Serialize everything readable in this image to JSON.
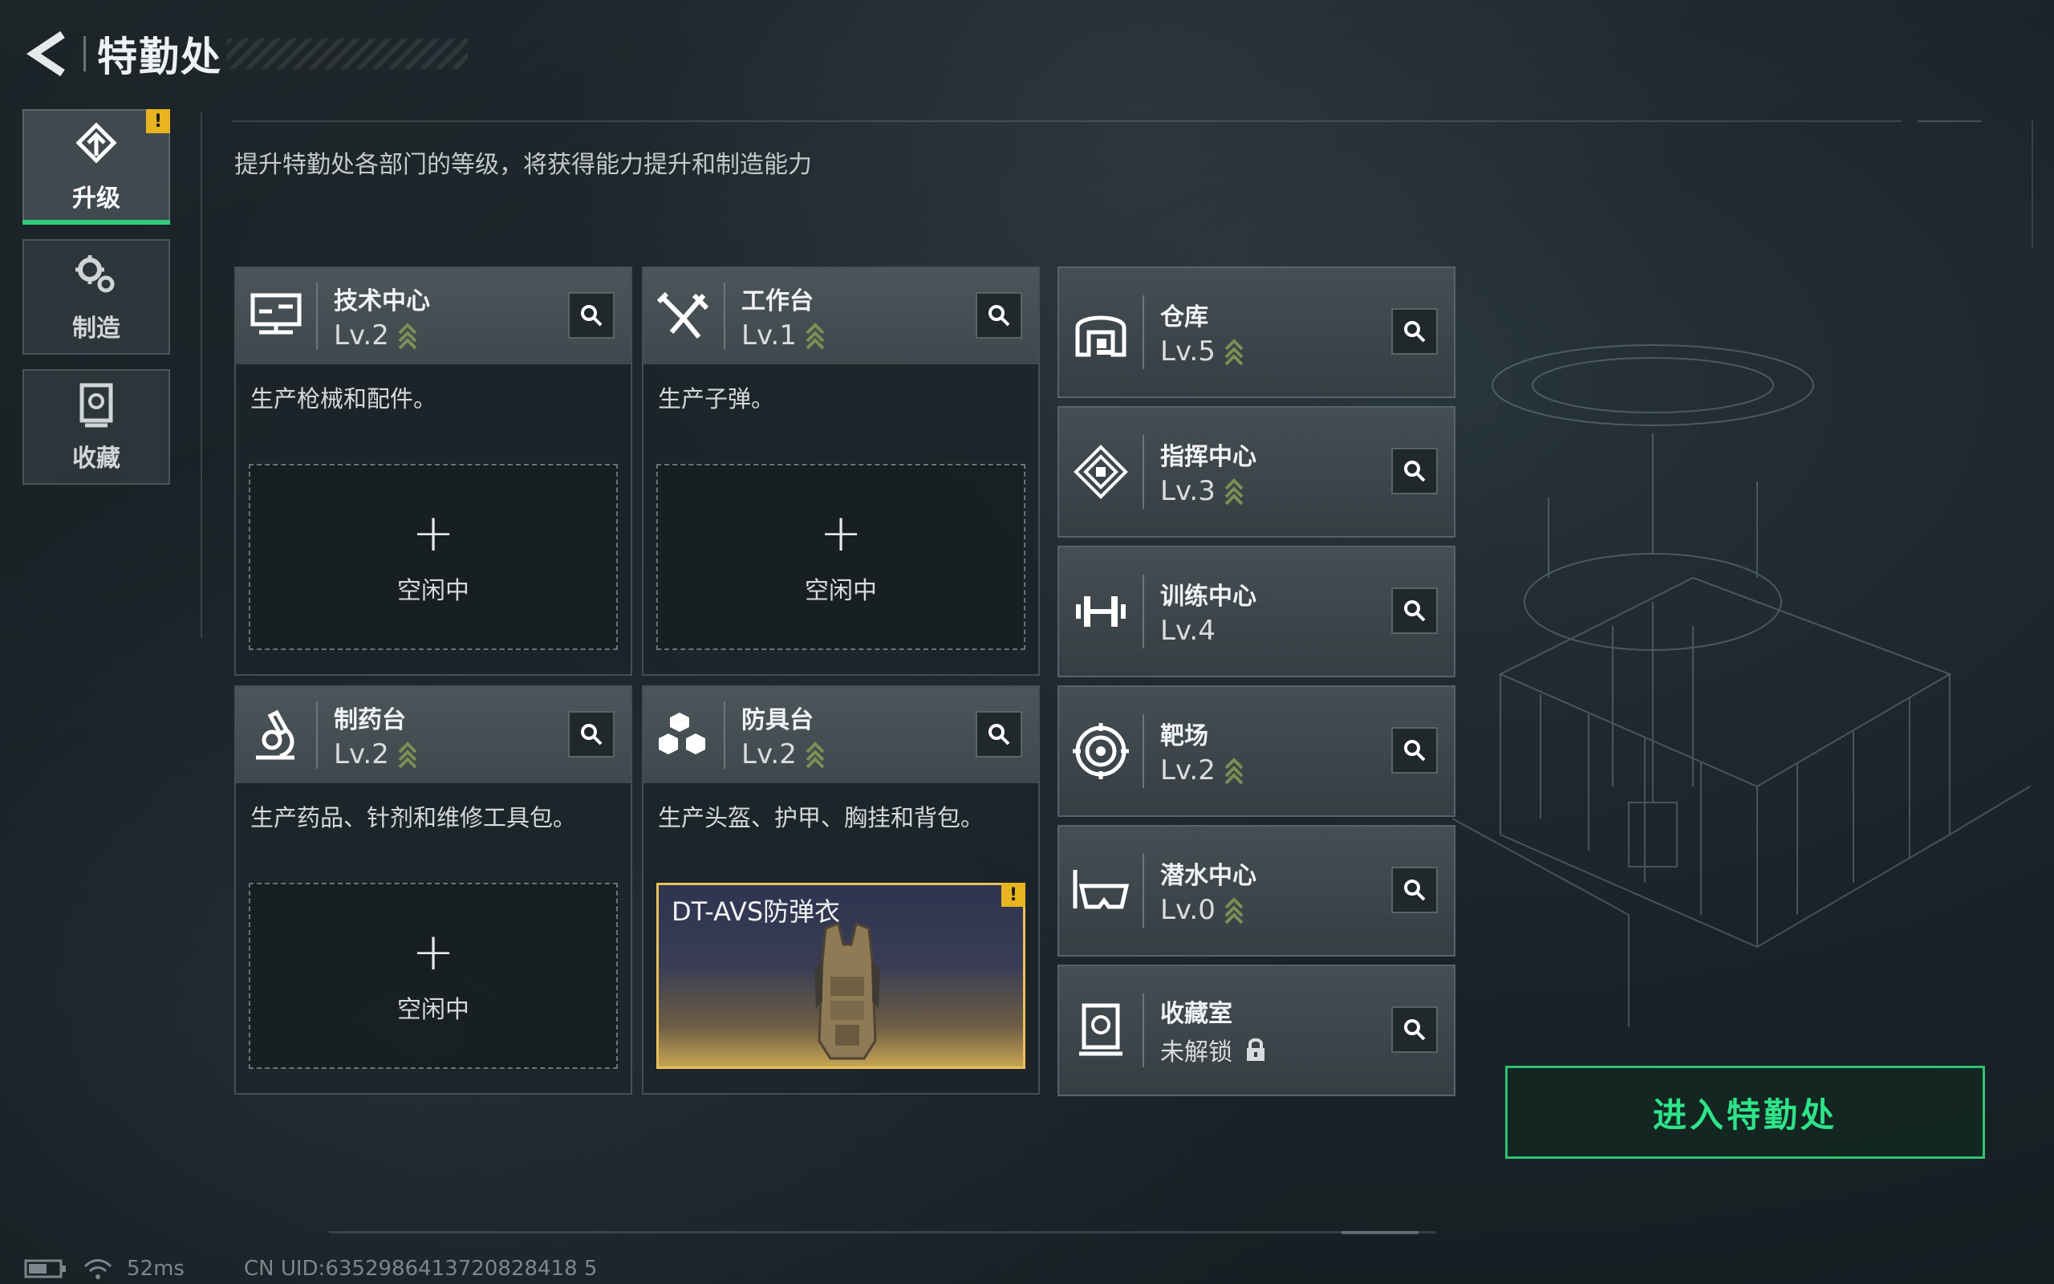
{
  "header": {
    "title": "特勤处"
  },
  "nav": [
    {
      "label": "升级",
      "icon": "upgrade-icon",
      "active": true,
      "alert": "!"
    },
    {
      "label": "制造",
      "icon": "gears-icon",
      "active": false
    },
    {
      "label": "收藏",
      "icon": "collection-icon",
      "active": false
    }
  ],
  "subtitle": "提升特勤处各部门的等级，将获得能力提升和制造能力",
  "cards": [
    {
      "name": "技术中心",
      "level": "Lv.2",
      "desc": "生产枪械和配件。",
      "slot": {
        "plus": "+",
        "label": "空闲中"
      }
    },
    {
      "name": "工作台",
      "level": "Lv.1",
      "desc": "生产子弹。",
      "slot": {
        "plus": "+",
        "label": "空闲中"
      }
    },
    {
      "name": "制药台",
      "level": "Lv.2",
      "desc": "生产药品、针剂和维修工具包。",
      "slot": {
        "plus": "+",
        "label": "空闲中"
      }
    },
    {
      "name": "防具台",
      "level": "Lv.2",
      "desc": "生产头盔、护甲、胸挂和背包。",
      "item": {
        "name": "DT-AVS防弹衣",
        "alert": "!"
      }
    }
  ],
  "facilities": [
    {
      "name": "仓库",
      "level": "Lv.5"
    },
    {
      "name": "指挥中心",
      "level": "Lv.3"
    },
    {
      "name": "训练中心",
      "level": "Lv.4"
    },
    {
      "name": "靶场",
      "level": "Lv.2"
    },
    {
      "name": "潜水中心",
      "level": "Lv.0"
    },
    {
      "name": "收藏室",
      "level": "未解锁"
    }
  ],
  "enter_button": "进入特勤处",
  "footer": {
    "ping": "52ms",
    "uid": "CN UID:6352986413720828418 5"
  },
  "colors": {
    "accent": "#2fcf7f",
    "alert": "#e8b420",
    "item_border": "#e8c15a",
    "upgrade_chevron": "#7a8f54"
  }
}
